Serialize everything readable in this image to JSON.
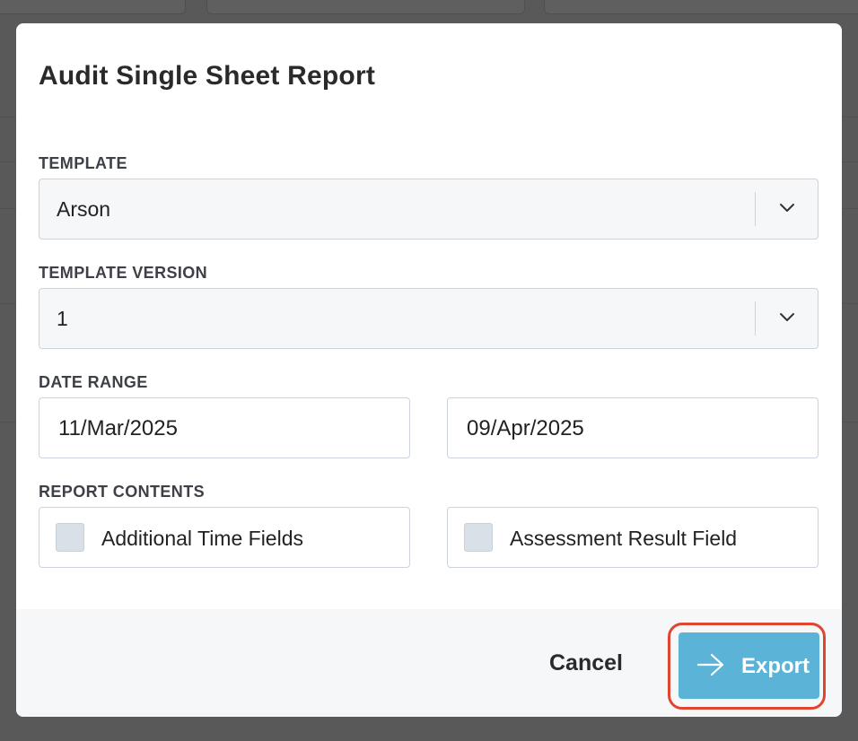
{
  "modal": {
    "title": "Audit Single Sheet Report",
    "template": {
      "label": "TEMPLATE",
      "value": "Arson",
      "icon": "chevron-down-icon"
    },
    "template_version": {
      "label": "TEMPLATE VERSION",
      "value": "1",
      "icon": "chevron-down-icon"
    },
    "date_range": {
      "label": "DATE RANGE",
      "start": "11/Mar/2025",
      "end": "09/Apr/2025"
    },
    "report_contents": {
      "label": "REPORT CONTENTS",
      "options": [
        {
          "label": "Additional Time Fields",
          "checked": false
        },
        {
          "label": "Assessment Result Field",
          "checked": false
        }
      ]
    },
    "footer": {
      "cancel_label": "Cancel",
      "export_label": "Export",
      "export_icon": "arrow-right-icon",
      "export_color": "#5bb4d8",
      "highlight_color": "#e0462f"
    }
  }
}
